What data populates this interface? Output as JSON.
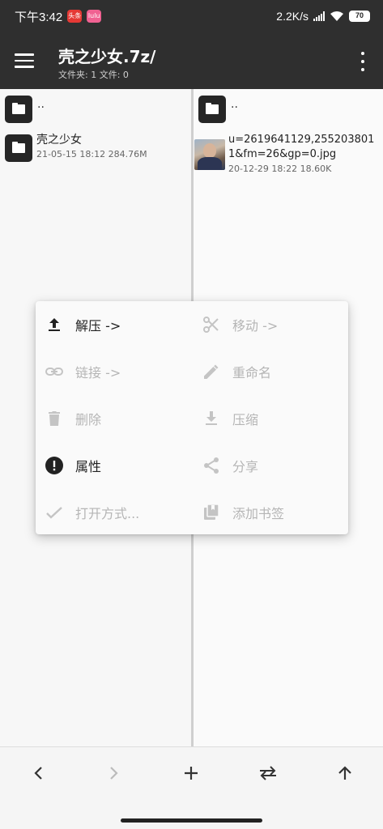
{
  "status": {
    "time": "下午3:42",
    "badge1": "头条",
    "badge2": "lulu",
    "net_speed": "2.2K/s",
    "battery": "70"
  },
  "app_bar": {
    "title": "壳之少女.7z/",
    "subtitle": "文件夹: 1  文件: 0"
  },
  "left_pane": {
    "parent": "..",
    "items": [
      {
        "name": "壳之少女",
        "meta": "21-05-15 18:12  284.76M"
      }
    ]
  },
  "right_pane": {
    "parent": "..",
    "items": [
      {
        "name": "u=2619641129,2552038011&fm=26&gp=0.jpg",
        "meta": "20-12-29 18:22  18.60K"
      }
    ]
  },
  "menu": {
    "extract": "解压 ->",
    "move": "移动 ->",
    "link": "链接 ->",
    "rename": "重命名",
    "delete": "删除",
    "compress": "压缩",
    "properties": "属性",
    "share": "分享",
    "open_with": "打开方式...",
    "bookmark": "添加书签"
  },
  "icons": {
    "menu": "hamburger-icon",
    "more": "more-vert-icon",
    "folder": "folder-icon",
    "extract": "upload-icon",
    "move": "scissors-icon",
    "link": "link-icon",
    "rename": "pencil-icon",
    "delete": "trash-icon",
    "compress": "download-icon",
    "properties": "info-icon",
    "share": "share-icon",
    "open_with": "check-icon",
    "bookmark": "bookmark-add-icon"
  },
  "colors": {
    "app_bar": "#2f2f2f",
    "enabled_text": "#222222",
    "disabled_text": "#b5b5b5"
  }
}
